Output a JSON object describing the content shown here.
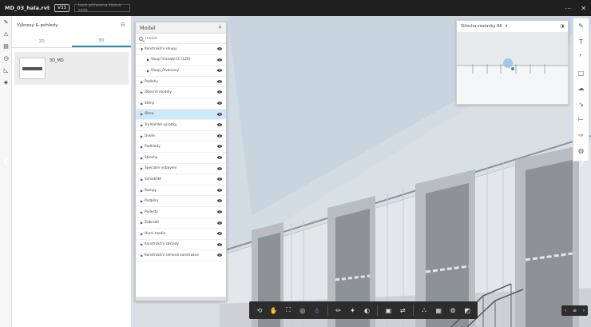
{
  "topbar": {
    "file_name": "MD_03_hala.rvt",
    "version": "V33",
    "comment_placeholder": "bent přiřazena žádná sada"
  },
  "left_tools": [
    "pencil-check-icon",
    "warning-icon",
    "sheets-icon",
    "history-icon",
    "measure-icon",
    "layers-icon"
  ],
  "sheets": {
    "title": "Výkresy & pohledy",
    "tabs": [
      {
        "label": "2D"
      },
      {
        "label": "3D"
      }
    ],
    "active_tab": "3D",
    "items": [
      {
        "label": "3D_MD"
      }
    ]
  },
  "model": {
    "title": "Model",
    "search_placeholder": "Hledat",
    "rows": [
      {
        "label": "Konstrukční sloupy",
        "expanded": true,
        "depth": 0
      },
      {
        "label": "Sloup hranatý.CC (L26)",
        "depth": 1
      },
      {
        "label": "Sloup_čtvercový",
        "depth": 1
      },
      {
        "label": "Podlahy",
        "depth": 0
      },
      {
        "label": "Obecné modely",
        "depth": 0
      },
      {
        "label": "Stěny",
        "depth": 0
      },
      {
        "label": "Okna",
        "depth": 0,
        "selected": true
      },
      {
        "label": "Truhlářské výrobky",
        "depth": 0
      },
      {
        "label": "Dveře",
        "depth": 0
      },
      {
        "label": "Podhledy",
        "depth": 0
      },
      {
        "label": "Střechy",
        "depth": 0
      },
      {
        "label": "Speciální vybavení",
        "depth": 0
      },
      {
        "label": "Schodiště",
        "depth": 0
      },
      {
        "label": "Rampy",
        "depth": 0
      },
      {
        "label": "Podpěry",
        "depth": 0
      },
      {
        "label": "Podesty",
        "depth": 0
      },
      {
        "label": "Zábradlí",
        "depth": 0
      },
      {
        "label": "Horní madla",
        "depth": 0
      },
      {
        "label": "Konstrukční základy",
        "depth": 0
      },
      {
        "label": "Konstrukční rámová konstrukce",
        "depth": 0
      }
    ]
  },
  "minimap": {
    "title": "Střecha vestavby B6"
  },
  "bottom_tools": {
    "active": "first-person-icon"
  },
  "colors": {
    "accent": "#2a8fa8",
    "selected_row": "#cde8f6",
    "toolbar_dark": "#2c2c2c"
  }
}
